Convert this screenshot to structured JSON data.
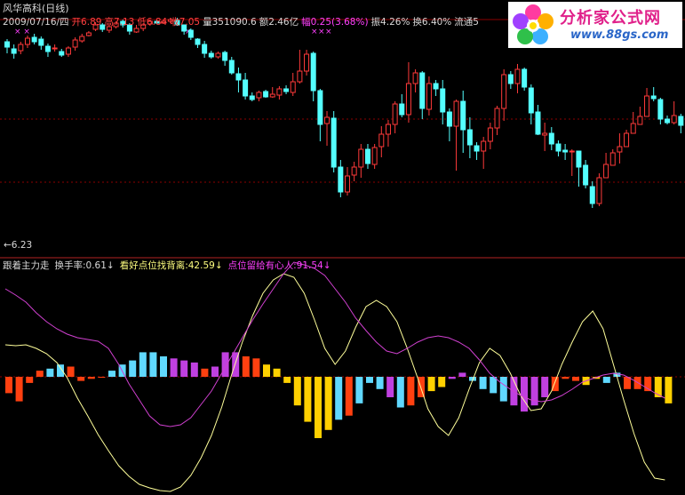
{
  "header": {
    "title": "风华高科(日线)",
    "info": [
      {
        "text": "2009/07/16/四",
        "color": "w"
      },
      {
        "text": "开6.89",
        "color": "r"
      },
      {
        "text": "高7.13",
        "color": "r"
      },
      {
        "text": "低6.84",
        "color": "r"
      },
      {
        "text": "收7.05",
        "color": "r"
      },
      {
        "text": "量351090.6",
        "color": "w"
      },
      {
        "text": "额2.46亿",
        "color": "w"
      },
      {
        "text": "幅0.25(3.68%)",
        "color": "m"
      },
      {
        "text": "振4.26%",
        "color": "w"
      },
      {
        "text": "换6.40%",
        "color": "w"
      },
      {
        "text": "流通5",
        "color": "w"
      }
    ]
  },
  "price_panel": {
    "low_marker": "←6.23"
  },
  "indicator": {
    "name": "跟着主力走",
    "items": [
      {
        "label": "换手率:0.61",
        "arrow": "↓",
        "color": "w"
      },
      {
        "label": "看好点位找背离:42.59",
        "arrow": "↓",
        "color": "y"
      },
      {
        "label": "点位留给有心人:91.54",
        "arrow": "↓",
        "color": "p"
      }
    ]
  },
  "logo": {
    "name": "分析家公式网",
    "url": "www.88gs.com"
  },
  "colors": {
    "up": "#ff3a3a",
    "down": "#54ffff",
    "yellow_line": "#ffff9a",
    "magenta_line": "#d040d0",
    "bar_orange": "#ff4010",
    "bar_yellow": "#ffd000",
    "bar_cyan": "#60d8ff",
    "bar_purple": "#c040e0",
    "grid": "#8b0000"
  },
  "chart_data": {
    "type": "candlestick",
    "candles": [
      [
        243,
        237,
        230,
        246
      ],
      [
        235,
        230,
        224,
        240
      ],
      [
        233,
        240,
        229,
        243
      ],
      [
        240,
        247,
        236,
        250
      ],
      [
        248,
        243,
        240,
        252
      ],
      [
        246,
        239,
        234,
        249
      ],
      [
        238,
        232,
        226,
        241
      ],
      [
        235,
        236,
        232,
        240
      ],
      [
        232,
        228,
        226,
        235
      ],
      [
        229,
        236,
        226,
        238
      ],
      [
        237,
        245,
        233,
        248
      ],
      [
        244,
        249,
        242,
        252
      ],
      [
        250,
        253,
        249,
        255
      ],
      [
        257,
        262,
        255,
        265
      ],
      [
        262,
        257,
        254,
        264
      ],
      [
        256,
        260,
        253,
        262
      ],
      [
        260,
        264,
        258,
        266
      ],
      [
        266,
        262,
        259,
        268
      ],
      [
        262,
        255,
        251,
        264
      ],
      [
        254,
        258,
        253,
        262
      ],
      [
        258,
        262,
        255,
        264
      ],
      [
        263,
        266,
        261,
        268
      ],
      [
        266,
        264,
        263,
        267
      ],
      [
        264,
        266,
        263,
        268
      ],
      [
        266,
        268,
        264,
        270
      ],
      [
        267,
        262,
        261,
        270
      ],
      [
        262,
        255,
        251,
        262
      ],
      [
        256,
        248,
        245,
        258
      ],
      [
        246,
        240,
        236,
        247
      ],
      [
        240,
        230,
        225,
        244
      ],
      [
        230,
        226,
        224,
        233
      ],
      [
        226,
        230,
        224,
        232
      ],
      [
        231,
        222,
        216,
        233
      ],
      [
        222,
        208,
        206,
        226
      ],
      [
        207,
        200,
        186,
        214
      ],
      [
        200,
        182,
        178,
        208
      ],
      [
        182,
        178,
        176,
        186
      ],
      [
        180,
        186,
        176,
        188
      ],
      [
        187,
        181,
        180,
        189
      ],
      [
        181,
        184,
        180,
        192
      ],
      [
        183,
        190,
        178,
        193
      ],
      [
        190,
        187,
        184,
        194
      ],
      [
        186,
        198,
        182,
        208
      ],
      [
        198,
        210,
        196,
        234
      ],
      [
        210,
        229,
        205,
        234
      ],
      [
        230,
        188,
        176,
        232
      ],
      [
        188,
        150,
        131,
        190
      ],
      [
        151,
        158,
        126,
        165
      ],
      [
        157,
        102,
        96,
        165
      ],
      [
        102,
        74,
        68,
        110
      ],
      [
        74,
        92,
        70,
        102
      ],
      [
        93,
        102,
        86,
        108
      ],
      [
        102,
        122,
        90,
        128
      ],
      [
        122,
        106,
        100,
        128
      ],
      [
        105,
        124,
        100,
        128
      ],
      [
        125,
        139,
        113,
        148
      ],
      [
        139,
        150,
        125,
        155
      ],
      [
        150,
        173,
        140,
        176
      ],
      [
        173,
        161,
        158,
        184
      ],
      [
        161,
        196,
        152,
        220
      ],
      [
        196,
        208,
        186,
        212
      ],
      [
        208,
        168,
        156,
        210
      ],
      [
        167,
        196,
        160,
        204
      ],
      [
        196,
        190,
        182,
        200
      ],
      [
        190,
        164,
        150,
        200
      ],
      [
        164,
        148,
        131,
        168
      ],
      [
        148,
        176,
        98,
        178
      ],
      [
        176,
        144,
        118,
        188
      ],
      [
        144,
        127,
        112,
        158
      ],
      [
        126,
        120,
        110,
        130
      ],
      [
        120,
        131,
        100,
        136
      ],
      [
        131,
        146,
        122,
        152
      ],
      [
        146,
        168,
        138,
        171
      ],
      [
        168,
        206,
        154,
        212
      ],
      [
        206,
        196,
        190,
        210
      ],
      [
        196,
        212,
        185,
        218
      ],
      [
        212,
        192,
        188,
        214
      ],
      [
        191,
        163,
        150,
        195
      ],
      [
        164,
        139,
        138,
        172
      ],
      [
        138,
        140,
        120,
        152
      ],
      [
        140,
        128,
        121,
        147
      ],
      [
        128,
        120,
        114,
        132
      ],
      [
        121,
        119,
        110,
        128
      ],
      [
        119,
        120,
        92,
        122
      ],
      [
        120,
        102,
        80,
        108
      ],
      [
        104,
        82,
        78,
        110
      ],
      [
        80,
        61,
        56,
        86
      ],
      [
        61,
        90,
        58,
        95
      ],
      [
        90,
        105,
        96,
        118
      ],
      [
        104,
        118,
        112,
        122
      ],
      [
        119,
        125,
        106,
        140
      ],
      [
        125,
        140,
        134,
        144
      ],
      [
        140,
        151,
        141,
        164
      ],
      [
        150,
        159,
        154,
        170
      ],
      [
        159,
        182,
        172,
        191
      ],
      [
        182,
        179,
        176,
        192
      ],
      [
        178,
        156,
        150,
        180
      ],
      [
        156,
        152,
        150,
        160
      ],
      [
        152,
        160,
        150,
        176
      ],
      [
        159,
        149,
        140,
        162
      ]
    ],
    "osc_bars": [
      [
        417,
        -8
      ],
      [
        414,
        -12
      ],
      [
        406,
        -3
      ],
      [
        432,
        3
      ],
      [
        436,
        4
      ],
      [
        428,
        6
      ],
      [
        431,
        5
      ],
      [
        415,
        -2
      ],
      [
        419,
        -1
      ],
      [
        421,
        0
      ],
      [
        434,
        3
      ],
      [
        443,
        6
      ],
      [
        452,
        8
      ],
      [
        453,
        12
      ],
      [
        447,
        12
      ],
      [
        444,
        10
      ],
      [
        440,
        9
      ],
      [
        437,
        8
      ],
      [
        432,
        7
      ],
      [
        426,
        4
      ],
      [
        437,
        5
      ],
      [
        445,
        12
      ],
      [
        447,
        12
      ],
      [
        432,
        10
      ],
      [
        434,
        9
      ],
      [
        428,
        6
      ],
      [
        425,
        4
      ],
      [
        421,
        -3
      ],
      [
        400,
        -14
      ],
      [
        387,
        -22
      ],
      [
        370,
        -30
      ],
      [
        376,
        -26
      ],
      [
        397,
        -21
      ],
      [
        405,
        -19
      ],
      [
        403,
        -13
      ],
      [
        412,
        -3
      ],
      [
        418,
        -6
      ],
      [
        427,
        -10
      ],
      [
        440,
        -15
      ],
      [
        432,
        -14
      ],
      [
        433,
        -10
      ],
      [
        430,
        -7
      ],
      [
        426,
        -5
      ],
      [
        420,
        -1
      ],
      [
        417,
        2
      ],
      [
        411,
        -2
      ],
      [
        405,
        -6
      ],
      [
        402,
        -8
      ],
      [
        396,
        -12
      ],
      [
        384,
        -14
      ],
      [
        379,
        -17
      ],
      [
        383,
        -14
      ],
      [
        388,
        -10
      ],
      [
        397,
        -7
      ],
      [
        413,
        -1
      ],
      [
        425,
        -2
      ],
      [
        427,
        -4
      ],
      [
        433,
        -1
      ],
      [
        431,
        -3
      ],
      [
        431,
        2
      ],
      [
        418,
        -6
      ],
      [
        420,
        -6
      ],
      [
        422,
        -7
      ],
      [
        424,
        -10
      ],
      [
        424,
        -13
      ]
    ],
    "osc_colors": [
      "o",
      "o",
      "o",
      "o",
      "c",
      "c",
      "o",
      "o",
      "o",
      "o",
      "c",
      "c",
      "c",
      "c",
      "c",
      "c",
      "p",
      "p",
      "p",
      "o",
      "p",
      "p",
      "p",
      "o",
      "o",
      "y",
      "y",
      "y",
      "y",
      "y",
      "y",
      "y",
      "c",
      "o",
      "c",
      "c",
      "c",
      "p",
      "c",
      "o",
      "o",
      "y",
      "y",
      "p",
      "p",
      "c",
      "c",
      "c",
      "c",
      "p",
      "p",
      "p",
      "p",
      "o",
      "o",
      "o",
      "y",
      "y",
      "c",
      "c",
      "o",
      "o",
      "o",
      "y",
      "y"
    ]
  }
}
